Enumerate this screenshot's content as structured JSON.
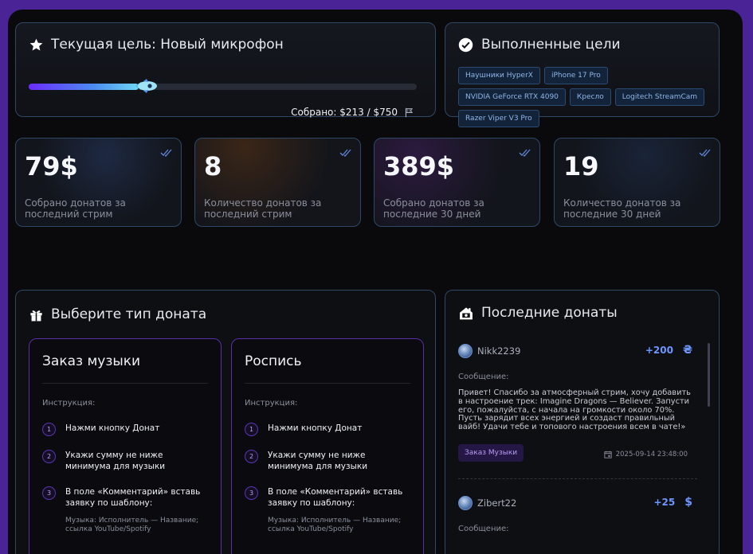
{
  "goal": {
    "title": "Текущая цель: Новый микрофон",
    "collected_label": "Собрано: $213 / $750",
    "progress": 0.284,
    "icons": [
      "star-icon",
      "rocket-icon",
      "flag-icon"
    ]
  },
  "done": {
    "title": "Выполненные цели",
    "items": [
      "Наушники HyperX",
      "iPhone 17 Pro",
      "NVIDIA GeForce RTX 4090",
      "Кресло",
      "Logitech StreamCam",
      "Razer Viper V3 Pro"
    ]
  },
  "stats": [
    {
      "value": "79$",
      "label": "Собрано донатов за последний стрим"
    },
    {
      "value": "8",
      "label": "Количество донатов за последний стрим"
    },
    {
      "value": "389$",
      "label": "Собрано донатов за последние 30 дней"
    },
    {
      "value": "19",
      "label": "Количество донатов за последние 30 дней"
    }
  ],
  "types": {
    "title": "Выберите тип доната",
    "cards": [
      {
        "name": "Заказ музыки",
        "instruction": "Инструкция:",
        "steps": [
          {
            "num": "1",
            "text": "Нажми кнопку Донат"
          },
          {
            "num": "2",
            "text": "Укажи сумму не ниже минимума для музыки"
          },
          {
            "num": "3",
            "text": "В поле «Комментарий» вставь заявку по шаблону:",
            "sub": "Музыка: Исполнитель — Название; ссылка YouTube/Spotify"
          }
        ]
      },
      {
        "name": "Роспись",
        "instruction": "Инструкция:",
        "steps": [
          {
            "num": "1",
            "text": "Нажми кнопку Донат"
          },
          {
            "num": "2",
            "text": "Укажи сумму не ниже минимума для музыки"
          },
          {
            "num": "3",
            "text": "В поле «Комментарий» вставь заявку по шаблону:",
            "sub": "Музыка: Исполнитель — Название; ссылка YouTube/Spotify"
          }
        ]
      }
    ]
  },
  "recent": {
    "title": "Последние донаты",
    "items": [
      {
        "user": "Nikk2239",
        "amount": "+200",
        "currency": "₴",
        "message_label": "Сообщение:",
        "message": "Привет! Спасибо за атмосферный стрим, хочу добавить в настроение трек: Imagine Dragons — Believer. Запусти его, пожалуйста, с начала на громкости около 70%. Пусть зарядит всех энергией и создаст правильный вайб! Удачи тебе и топового настроения всем в чате!»",
        "badge": "Заказ Музыки",
        "date": "2025-09-14 23:48:00"
      },
      {
        "user": "Zibert22",
        "amount": "+25",
        "currency": "$",
        "message_label": "Сообщение:"
      }
    ]
  },
  "colors": {
    "accent_purple": "#6a2cff",
    "accent_blue": "#6d96ff",
    "border": "#2e4866"
  }
}
